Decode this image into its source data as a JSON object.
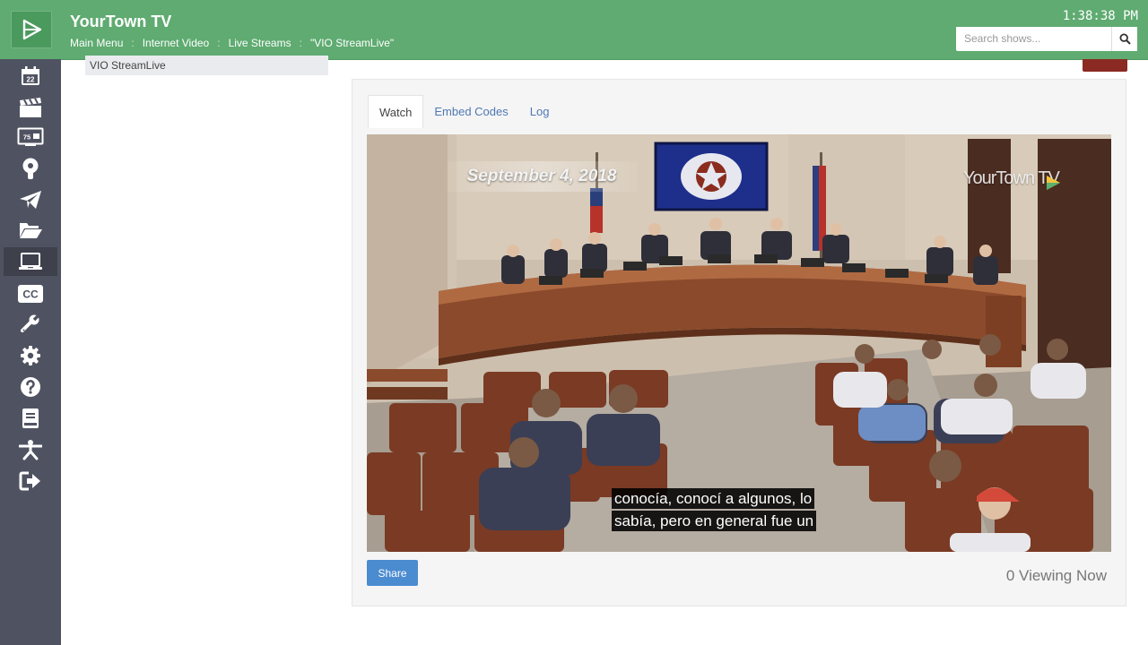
{
  "header": {
    "app_title": "YourTown TV",
    "clock": "1:38:38 PM",
    "breadcrumb": [
      "Main Menu",
      "Internet Video",
      "Live Streams",
      "\"VIO StreamLive\""
    ],
    "search": {
      "placeholder": "Search shows..."
    }
  },
  "sidebar": {
    "items": [
      {
        "name": "calendar",
        "label": "22",
        "active": false
      },
      {
        "name": "clapperboard",
        "active": false
      },
      {
        "name": "tv-channel",
        "label": "75",
        "active": false
      },
      {
        "name": "podcast",
        "active": false
      },
      {
        "name": "paper-plane",
        "active": false
      },
      {
        "name": "folder-open",
        "active": false
      },
      {
        "name": "laptop",
        "active": true
      },
      {
        "name": "closed-captions",
        "label": "CC",
        "active": false
      },
      {
        "name": "wrench",
        "active": false
      },
      {
        "name": "gear",
        "active": false
      },
      {
        "name": "help",
        "active": false
      },
      {
        "name": "book",
        "active": false
      },
      {
        "name": "accessibility",
        "active": false
      },
      {
        "name": "sign-out",
        "active": false
      }
    ]
  },
  "main": {
    "stream_list_item": "VIO StreamLive",
    "tabs": [
      "Watch",
      "Embed Codes",
      "Log"
    ],
    "active_tab": "Watch",
    "video": {
      "date_overlay": "September 4, 2018",
      "watermark": "YourTown TV",
      "captions": [
        "conocía, conocí a algunos, lo",
        "sabía, pero en general fue un"
      ]
    },
    "share_label": "Share",
    "viewing_now": "0 Viewing Now"
  },
  "colors": {
    "header_green": "#5fab71",
    "sidebar": "#4f5361",
    "link_blue": "#4f78b4",
    "share_blue": "#4b8bd0"
  }
}
